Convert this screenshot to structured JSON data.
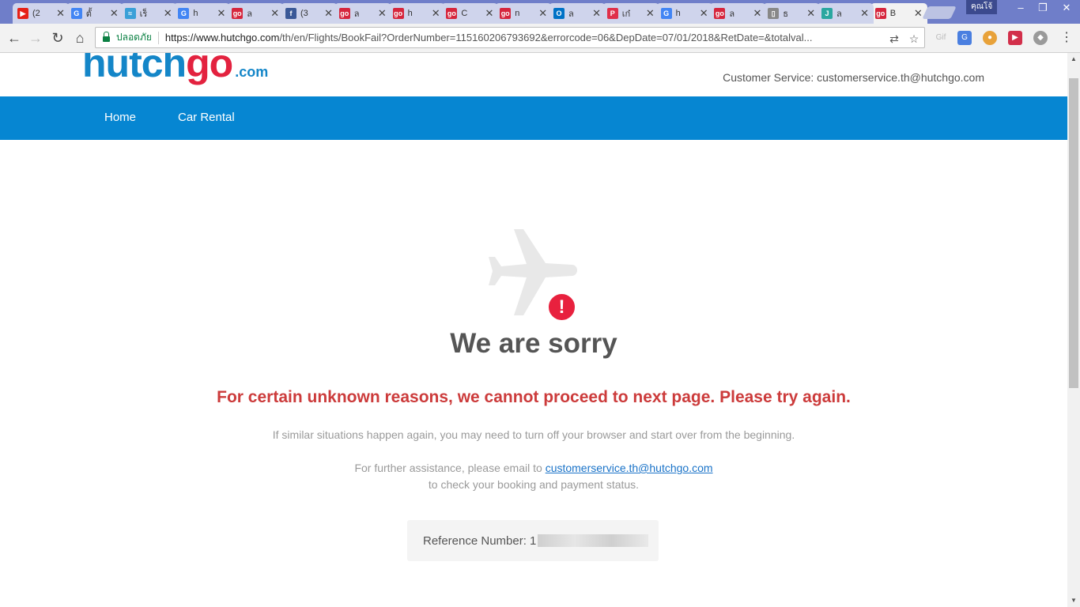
{
  "tabs": [
    {
      "title": "(2",
      "icon": "youtube-icon",
      "color": "#e62117",
      "glyph": "▶"
    },
    {
      "title": "ตั้",
      "icon": "google-icon",
      "color": "#4285f4",
      "glyph": "G"
    },
    {
      "title": "เร็",
      "icon": "wifi-icon",
      "color": "#3aa0d8",
      "glyph": "≈"
    },
    {
      "title": "h",
      "icon": "google-icon",
      "color": "#4285f4",
      "glyph": "G"
    },
    {
      "title": "ล",
      "icon": "hutchgo-icon",
      "color": "#d6263d",
      "glyph": "go"
    },
    {
      "title": "(3",
      "icon": "facebook-icon",
      "color": "#3b5998",
      "glyph": "f"
    },
    {
      "title": "ล",
      "icon": "hutchgo-icon",
      "color": "#d6263d",
      "glyph": "go"
    },
    {
      "title": "h",
      "icon": "hutchgo-icon",
      "color": "#d6263d",
      "glyph": "go"
    },
    {
      "title": "C",
      "icon": "hutchgo-icon",
      "color": "#d6263d",
      "glyph": "go"
    },
    {
      "title": "n",
      "icon": "hutchgo-icon",
      "color": "#d6263d",
      "glyph": "go"
    },
    {
      "title": "ล",
      "icon": "outlook-icon",
      "color": "#0072c6",
      "glyph": "O"
    },
    {
      "title": "เก๋",
      "icon": "pinterest-icon",
      "color": "#e0304a",
      "glyph": "P"
    },
    {
      "title": "h",
      "icon": "google-icon",
      "color": "#4285f4",
      "glyph": "G"
    },
    {
      "title": "ล",
      "icon": "hutchgo-icon",
      "color": "#d6263d",
      "glyph": "go"
    },
    {
      "title": "ธ",
      "icon": "document-icon",
      "color": "#888888",
      "glyph": "▯"
    },
    {
      "title": "ล",
      "icon": "jtab-icon",
      "color": "#2aa7a0",
      "glyph": "J"
    },
    {
      "title": "B",
      "icon": "hutchgo-icon",
      "color": "#d6263d",
      "glyph": "go",
      "active": true
    }
  ],
  "profile": "คุณโจ้",
  "omnibox": {
    "secure_label": "ปลอดภัย",
    "url_host": "https://www.hutchgo.com",
    "url_path": "/th/en/Flights/BookFail?OrderNumber=115160206793692&errorcode=06&DepDate=07/01/2018&RetDate=&totalval..."
  },
  "ext_gif": "Gif",
  "page": {
    "logo_main": "hutch",
    "logo_accent": "go",
    "logo_suffix": ".com",
    "customer_service": "Customer Service: customerservice.th@hutchgo.com",
    "nav": [
      "Home",
      "Car Rental"
    ],
    "heading": "We are sorry",
    "reason": "For certain unknown reasons, we cannot proceed to next page. Please try again.",
    "hint": "If similar situations happen again, you may need to turn off your browser and start over from the beginning.",
    "assist_prefix": "For further assistance, please email to",
    "assist_email": "customerservice.th@hutchgo.com",
    "assist_suffix": "to check your booking and payment status.",
    "reference_label": "Reference Number: 1"
  },
  "colors": {
    "brand_blue": "#0686d2",
    "brand_red": "#e3223f",
    "error_red": "#cc3b3b"
  }
}
